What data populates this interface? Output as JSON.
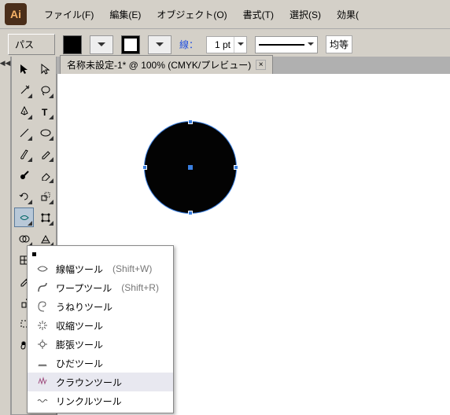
{
  "app": {
    "logo": "Ai"
  },
  "menu": {
    "file": "ファイル(F)",
    "edit": "編集(E)",
    "object": "オブジェクト(O)",
    "type": "書式(T)",
    "select": "選択(S)",
    "effect": "効果("
  },
  "options": {
    "selection_name": "パス",
    "stroke_label": "線：",
    "stroke_width": "1 pt",
    "profile_label": "均等"
  },
  "tab": {
    "title": "名称未設定-1* @ 100% (CMYK/プレビュー)"
  },
  "flyout": {
    "items": [
      {
        "label": "線幅ツール",
        "shortcut": "(Shift+W)"
      },
      {
        "label": "ワープツール",
        "shortcut": "(Shift+R)"
      },
      {
        "label": "うねりツール",
        "shortcut": ""
      },
      {
        "label": "収縮ツール",
        "shortcut": ""
      },
      {
        "label": "膨張ツール",
        "shortcut": ""
      },
      {
        "label": "ひだツール",
        "shortcut": ""
      },
      {
        "label": "クラウンツール",
        "shortcut": ""
      },
      {
        "label": "リンクルツール",
        "shortcut": ""
      }
    ]
  }
}
